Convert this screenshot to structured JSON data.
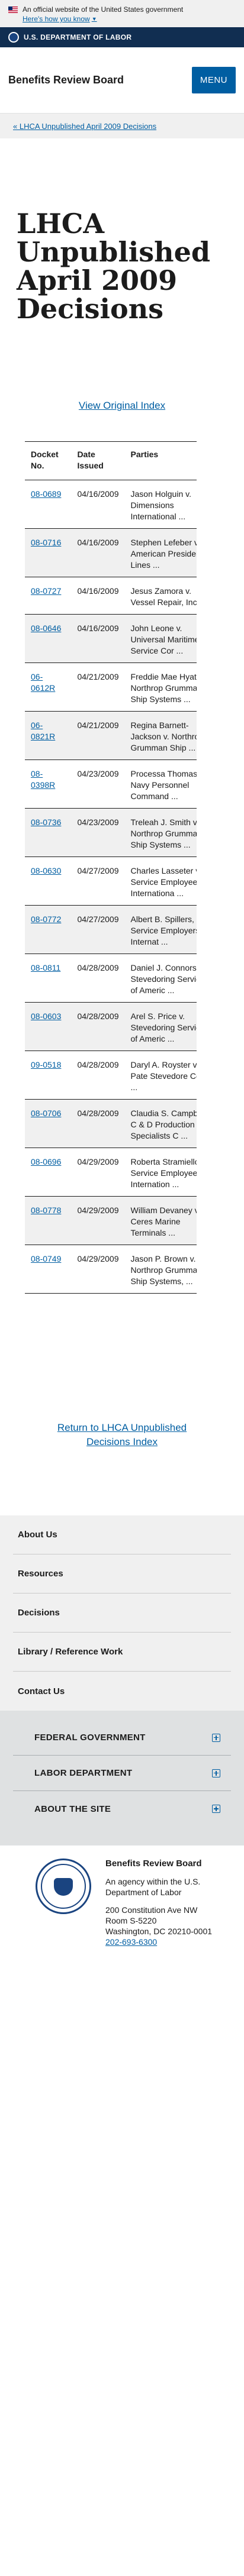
{
  "banner": {
    "official_text": "An official website of the United States government",
    "link_text": "Here's how you know"
  },
  "dol_bar": {
    "name": "U.S. DEPARTMENT OF LABOR"
  },
  "header": {
    "title": "Benefits Review Board",
    "menu_label": "MENU"
  },
  "breadcrumb": {
    "text": "« LHCA Unpublished April 2009 Decisions"
  },
  "page": {
    "title": "LHCA Unpublished April 2009 Decisions",
    "view_original": "View Original Index",
    "return_link": "Return to LHCA Unpublished Decisions Index"
  },
  "table": {
    "headers": [
      "Docket No.",
      "Date Issued",
      "Parties"
    ],
    "rows": [
      {
        "docket": "08-0689",
        "date": "04/16/2009",
        "parties": "Jason Holguin v. Dimensions International ..."
      },
      {
        "docket": "08-0716",
        "date": "04/16/2009",
        "parties": "Stephen Lefeber v. American President Lines ..."
      },
      {
        "docket": "08-0727",
        "date": "04/16/2009",
        "parties": "Jesus Zamora v. Vessel Repair, Inc. ..."
      },
      {
        "docket": "08-0646",
        "date": "04/16/2009",
        "parties": "John Leone v. Universal Maritime Service Cor ..."
      },
      {
        "docket": "06-0612R",
        "date": "04/21/2009",
        "parties": "Freddie Mae Hyatt v. Northrop Grumman Ship Systems ..."
      },
      {
        "docket": "06-0821R",
        "date": "04/21/2009",
        "parties": "Regina Barnett-Jackson v. Northrop Grumman Ship ..."
      },
      {
        "docket": "08-0398R",
        "date": "04/23/2009",
        "parties": "Processa Thomas v. Navy Personnel Command ..."
      },
      {
        "docket": "08-0736",
        "date": "04/23/2009",
        "parties": "Treleah J. Smith v. Northrop Grumman Ship Systems ..."
      },
      {
        "docket": "08-0630",
        "date": "04/27/2009",
        "parties": "Charles Lasseter v. Service Employees Internationa ..."
      },
      {
        "docket": "08-0772",
        "date": "04/27/2009",
        "parties": "Albert B. Spillers, Jr. v. Service Employers Internat ..."
      },
      {
        "docket": "08-0811",
        "date": "04/28/2009",
        "parties": "Daniel J. Connors v. Stevedoring Services of Americ ..."
      },
      {
        "docket": "08-0603",
        "date": "04/28/2009",
        "parties": "Arel S. Price v. Stevedoring Services of Americ ..."
      },
      {
        "docket": "09-0518",
        "date": "04/28/2009",
        "parties": "Daryl A. Royster v. Pate Stevedore Co., ..."
      },
      {
        "docket": "08-0706",
        "date": "04/28/2009",
        "parties": "Claudia S. Campbell v. C & D Production Specialists C ..."
      },
      {
        "docket": "08-0696",
        "date": "04/29/2009",
        "parties": "Roberta Stramiello v. Service Employees Internation ..."
      },
      {
        "docket": "08-0778",
        "date": "04/29/2009",
        "parties": "William Devaney v. Ceres Marine Terminals ..."
      },
      {
        "docket": "08-0749",
        "date": "04/29/2009",
        "parties": "Jason P. Brown v. Northrop Grumman Ship Systems, ..."
      }
    ]
  },
  "footer_nav": [
    "About Us",
    "Resources",
    "Decisions",
    "Library / Reference Work",
    "Contact Us"
  ],
  "footer_accordion": [
    "FEDERAL GOVERNMENT",
    "LABOR DEPARTMENT",
    "ABOUT THE SITE"
  ],
  "footer": {
    "org": "Benefits Review Board",
    "agency": "An agency within the U.S. Department of Labor",
    "address1": "200 Constitution Ave NW",
    "address2": "Room S-5220",
    "address3": "Washington, DC 20210-0001",
    "phone": "202-693-6300"
  }
}
